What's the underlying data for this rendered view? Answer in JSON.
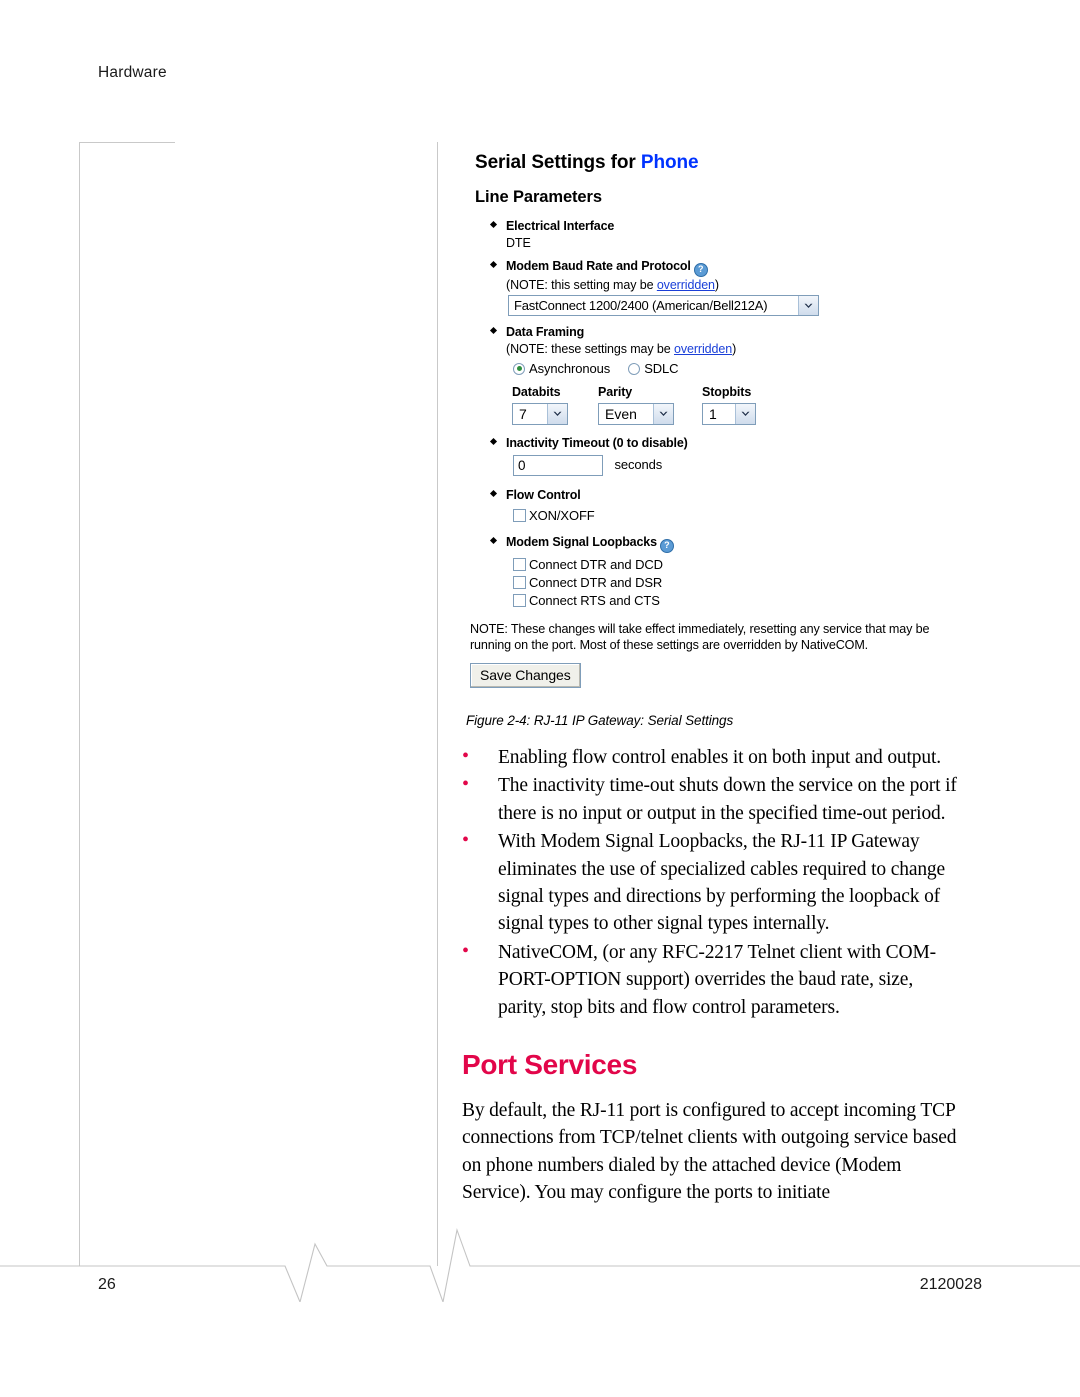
{
  "running_head": "Hardware",
  "footer": {
    "page_number": "26",
    "doc_number": "2120028"
  },
  "figure": {
    "title_prefix": "Serial Settings for ",
    "title_highlight": "Phone",
    "title_highlight_color": "#0033ff",
    "subtitle": "Line Parameters",
    "params": [
      {
        "label": "Electrical Interface",
        "value": "DTE"
      },
      {
        "label": "Modem Baud Rate and Protocol",
        "help_icon": "help-circle-icon",
        "note_prefix": "(NOTE: this setting may be ",
        "note_link": "overridden",
        "note_suffix": ")",
        "select_value": "FastConnect 1200/2400 (American/Bell212A)"
      },
      {
        "label": "Data Framing",
        "note_prefix": "(NOTE: these settings may be ",
        "note_link": "overridden",
        "note_suffix": ")",
        "radios": [
          {
            "label": "Asynchronous",
            "selected": true
          },
          {
            "label": "SDLC",
            "selected": false
          }
        ],
        "framing_columns": [
          {
            "header": "Databits",
            "value": "7"
          },
          {
            "header": "Parity",
            "value": "Even"
          },
          {
            "header": "Stopbits",
            "value": "1"
          }
        ]
      },
      {
        "label": "Inactivity Timeout (0 to disable)",
        "input_value": "0",
        "unit": "seconds"
      },
      {
        "label": "Flow Control",
        "checkboxes": [
          {
            "label": "XON/XOFF",
            "checked": false
          }
        ]
      },
      {
        "label": "Modem Signal Loopbacks",
        "help_icon": "help-circle-icon",
        "checkboxes": [
          {
            "label": "Connect DTR and DCD",
            "checked": false
          },
          {
            "label": "Connect DTR and DSR",
            "checked": false
          },
          {
            "label": "Connect RTS and CTS",
            "checked": false
          }
        ]
      }
    ],
    "bottom_note": "NOTE: These changes will take effect immediately, resetting any service that may be running on the port. Most of these settings are overridden by NativeCOM.",
    "save_button": "Save Changes",
    "caption": "Figure 2-4:  RJ-11 IP Gateway: Serial Settings"
  },
  "body": {
    "bullet_color": "#e2064a",
    "bullets": [
      "Enabling flow control enables it on both input and output.",
      "The inactivity time-out shuts down the service on the port if there is no input or output in the specified time-out period.",
      "With Modem Signal Loopbacks, the  RJ-11 IP Gateway eliminates the use of specialized cables required to change signal types and directions by performing the loopback of signal types to other signal types internally.",
      "NativeCOM, (or any RFC-2217 Telnet client with COM-PORT-OPTION support) overrides the baud rate, size, parity, stop bits and flow control parameters."
    ],
    "section_heading": "Port Services",
    "section_heading_color": "#e2064a",
    "paragraph": "By default, the RJ-11 port is configured to accept incoming TCP connections from TCP/telnet clients with outgoing service based on phone numbers dialed by the attached device (Modem Service). You may configure the ports to initiate"
  }
}
